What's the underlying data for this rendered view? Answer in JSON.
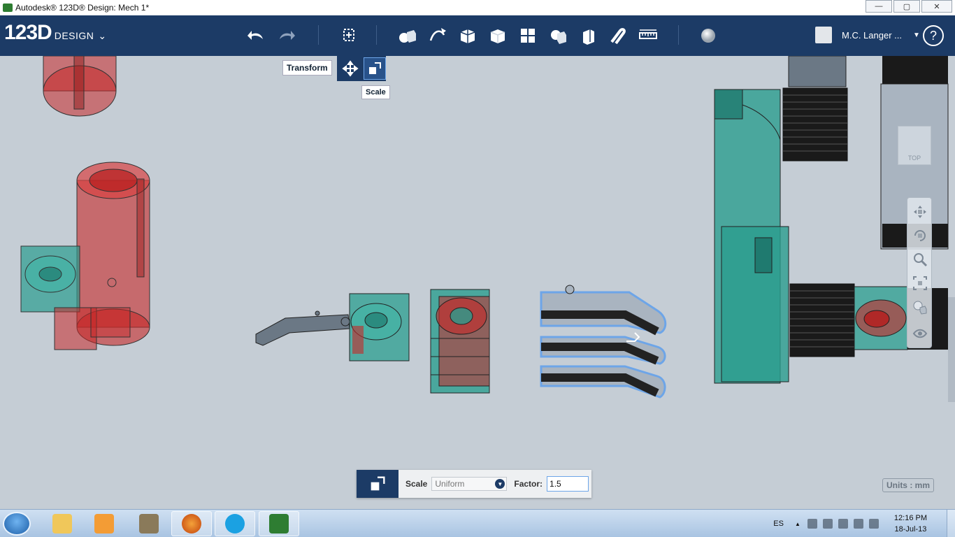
{
  "window": {
    "title": "Autodesk® 123D® Design: Mech 1*",
    "controls": {
      "minimize": "—",
      "maximize": "▢",
      "close": "✕"
    }
  },
  "header": {
    "logo_big": "123D",
    "logo_small": "DESIGN",
    "logo_chevron": "⌄",
    "tools": [
      "undo-icon",
      "redo-icon",
      "transform-icon",
      "primitives-icon",
      "sketch-icon",
      "construct-icon",
      "modify-icon",
      "pattern-icon",
      "grouping-icon",
      "combine-icon",
      "snap-icon",
      "measure-icon",
      "material-icon"
    ],
    "user_name": "M.C. Langer ...",
    "user_caret": "▼",
    "help": "?"
  },
  "flyout": {
    "tooltip_transform": "Transform",
    "tooltip_scale": "Scale"
  },
  "viewcube": {
    "face": "TOP"
  },
  "scale_panel": {
    "label_scale": "Scale",
    "mode": "Uniform",
    "label_factor": "Factor:",
    "factor_value": "1.5"
  },
  "units": "Units : mm",
  "taskbar": {
    "language": "ES",
    "time": "12:16 PM",
    "date": "18-Jul-13",
    "apps": [
      "explorer",
      "media-player",
      "app-3",
      "firefox",
      "skype",
      "123d-design"
    ]
  },
  "colors": {
    "header": "#1c3b66",
    "viewport": "#c5cdd5",
    "teal": "#2a9d8f",
    "red": "#c62828",
    "selection": "#6da5e8"
  }
}
